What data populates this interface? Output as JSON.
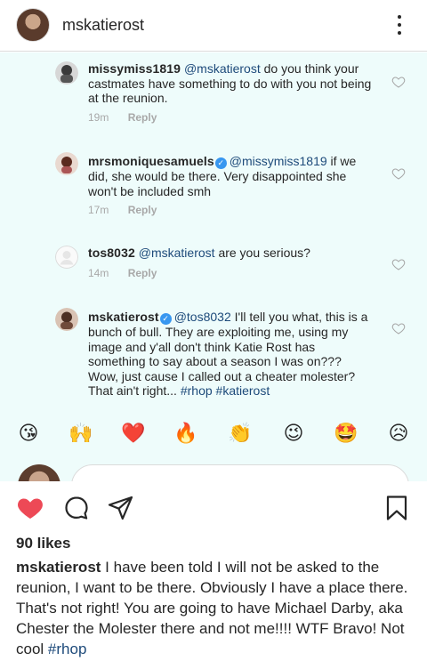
{
  "header": {
    "username": "mskatierost",
    "more_icon": "more-vertical-icon"
  },
  "comments": [
    {
      "user": "missymiss1819",
      "verified": false,
      "mention": "@mskatierost",
      "text": "do you think your castmates have something to do with you not being at the reunion.",
      "time": "19m",
      "reply": "Reply"
    },
    {
      "user": "mrsmoniquesamuels",
      "verified": true,
      "mention": "@missymiss1819",
      "text": "if we did, she would be there. Very disappointed she won't be included smh",
      "time": "17m",
      "reply": "Reply"
    },
    {
      "user": "tos8032",
      "verified": false,
      "mention": "@mskatierost",
      "text": "are you serious?",
      "time": "14m",
      "reply": "Reply"
    },
    {
      "user": "mskatierost",
      "verified": true,
      "mention": "@tos8032",
      "text": "I'll tell you what, this is a bunch of bull. They are exploiting me, using my image and y'all don't think Katie Rost has something to say about a season I was on??? Wow, just cause I called out a cheater molester? That ain't right...",
      "tags": "#rhop #katierost"
    }
  ],
  "emoji_bar": [
    "😘",
    "🙌",
    "❤️",
    "🔥",
    "👏",
    "😉",
    "🤩",
    "😥"
  ],
  "actions": {
    "like_icon": "heart-filled-icon",
    "comment_icon": "comment-icon",
    "share_icon": "send-icon",
    "save_icon": "bookmark-icon",
    "like_color": "#ed4956"
  },
  "post": {
    "likes": "90 likes",
    "caption_user": "mskatierost",
    "caption_text": "I have been told I will not be asked to the reunion, I want to be there. Obviously I have a place there. That's not right! You are going to have Michael Darby, aka Chester the Molester there and not me!!!! WTF Bravo! Not cool",
    "caption_tag": "#rhop"
  }
}
